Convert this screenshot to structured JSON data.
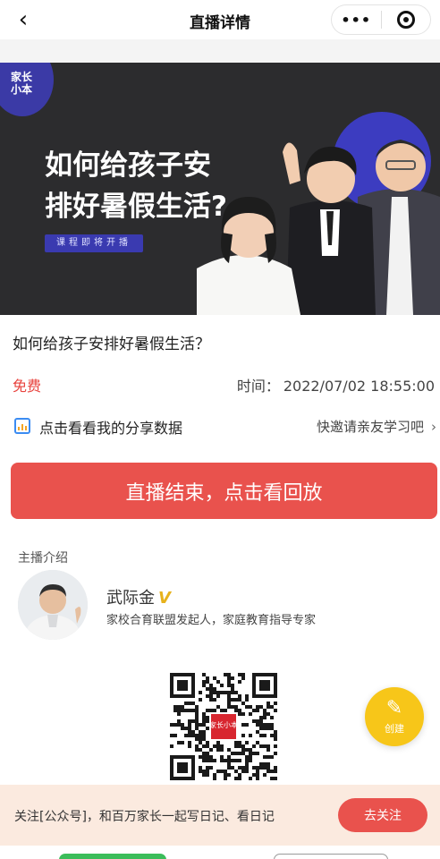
{
  "header": {
    "back_glyph": "‹",
    "title": "直播详情",
    "more_glyph": "•••",
    "icons": [
      "back-arrow-icon",
      "more-dots-icon",
      "target-circle-icon"
    ]
  },
  "banner": {
    "logo_text": "家长\n小本",
    "heading_line1": "如何给孩子安",
    "heading_line2": "排好暑假生活?",
    "tag": "课程即将开播"
  },
  "course": {
    "title": "如何给孩子安排好暑假生活？",
    "price": "免费",
    "time_label": "时间：",
    "time_value": "2022/07/02 18:55:00",
    "accent_color": "#e8433e"
  },
  "share": {
    "text": "点击看看我的分享数据",
    "invite": "快邀请亲友学习吧",
    "invite_chevron": "›"
  },
  "replay_button": "直播结束，点击看回放",
  "host": {
    "section_title": "主播介绍",
    "name": "武际金",
    "verified_glyph": "V",
    "description": "家校合育联盟发起人，家庭教育指导专家"
  },
  "qr": {
    "center_logo": "家长\n小本"
  },
  "fab": {
    "pen_glyph": "✎",
    "label": "创建"
  },
  "follow": {
    "text": "关注[公众号]，和百万家长一起写日记、看日记",
    "button": "去关注"
  }
}
